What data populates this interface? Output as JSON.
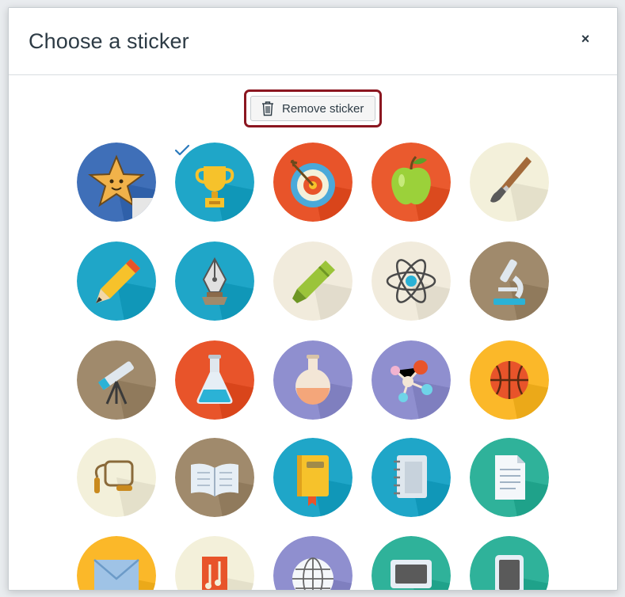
{
  "dialog": {
    "title": "Choose a sticker",
    "close_label": "×",
    "remove_button_label": "Remove sticker"
  },
  "stickers": [
    {
      "name": "star",
      "bg": "#3f6fb8",
      "selected": false
    },
    {
      "name": "trophy",
      "bg": "#1fa6c8",
      "selected": true
    },
    {
      "name": "target",
      "bg": "#e8542a",
      "selected": false
    },
    {
      "name": "apple",
      "bg": "#ea5a2e",
      "selected": false
    },
    {
      "name": "paintbrush",
      "bg": "#f3f0da",
      "selected": false
    },
    {
      "name": "pencil",
      "bg": "#1fa6c8",
      "selected": false
    },
    {
      "name": "pen-nib",
      "bg": "#1fa6c8",
      "selected": false
    },
    {
      "name": "highlighter",
      "bg": "#f1ebdc",
      "selected": false
    },
    {
      "name": "atom",
      "bg": "#f1ebdc",
      "selected": false
    },
    {
      "name": "microscope",
      "bg": "#a08a6c",
      "selected": false
    },
    {
      "name": "telescope",
      "bg": "#a08a6c",
      "selected": false
    },
    {
      "name": "flask",
      "bg": "#e8542a",
      "selected": false
    },
    {
      "name": "beaker",
      "bg": "#8f8fcf",
      "selected": false
    },
    {
      "name": "molecule",
      "bg": "#8f8fcf",
      "selected": false
    },
    {
      "name": "basketball",
      "bg": "#fbb829",
      "selected": false
    },
    {
      "name": "jump-rope",
      "bg": "#f3f0da",
      "selected": false
    },
    {
      "name": "book-open",
      "bg": "#a08a6c",
      "selected": false
    },
    {
      "name": "book",
      "bg": "#1fa6c8",
      "selected": false
    },
    {
      "name": "notebook",
      "bg": "#1fa6c8",
      "selected": false
    },
    {
      "name": "document",
      "bg": "#2fb29a",
      "selected": false
    },
    {
      "name": "envelope",
      "bg": "#fbb829",
      "selected": false
    },
    {
      "name": "music",
      "bg": "#f3f0da",
      "selected": false
    },
    {
      "name": "globe",
      "bg": "#8f8fcf",
      "selected": false
    },
    {
      "name": "monitor",
      "bg": "#2fb29a",
      "selected": false
    },
    {
      "name": "tablet",
      "bg": "#2fb29a",
      "selected": false
    }
  ]
}
